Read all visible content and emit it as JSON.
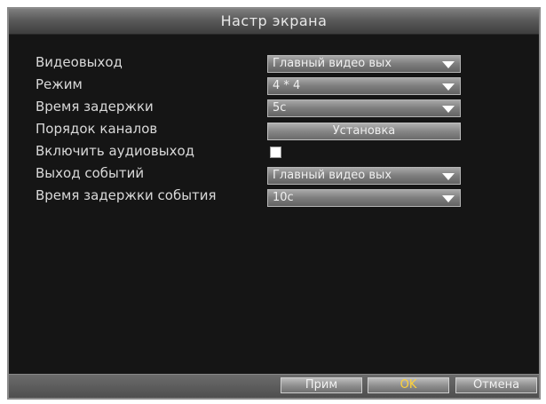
{
  "dialog": {
    "title": "Настр экрана"
  },
  "settings": {
    "video_output_label": "Видеовыход",
    "video_output_value": "Главный видео вых",
    "mode_label": "Режим",
    "mode_value": "4 * 4",
    "delay_label": "Время задержки",
    "delay_value": "5c",
    "channel_order_label": "Порядок каналов",
    "channel_order_button": "Установка",
    "audio_output_label": "Включить аудиовыход",
    "audio_output_checked": false,
    "event_output_label": "Выход событий",
    "event_output_value": "Главный видео вых",
    "event_delay_label": "Время задержки события",
    "event_delay_value": "10c"
  },
  "footer": {
    "apply_label": "Прим",
    "ok_label": "OK",
    "cancel_label": "Отмена"
  }
}
